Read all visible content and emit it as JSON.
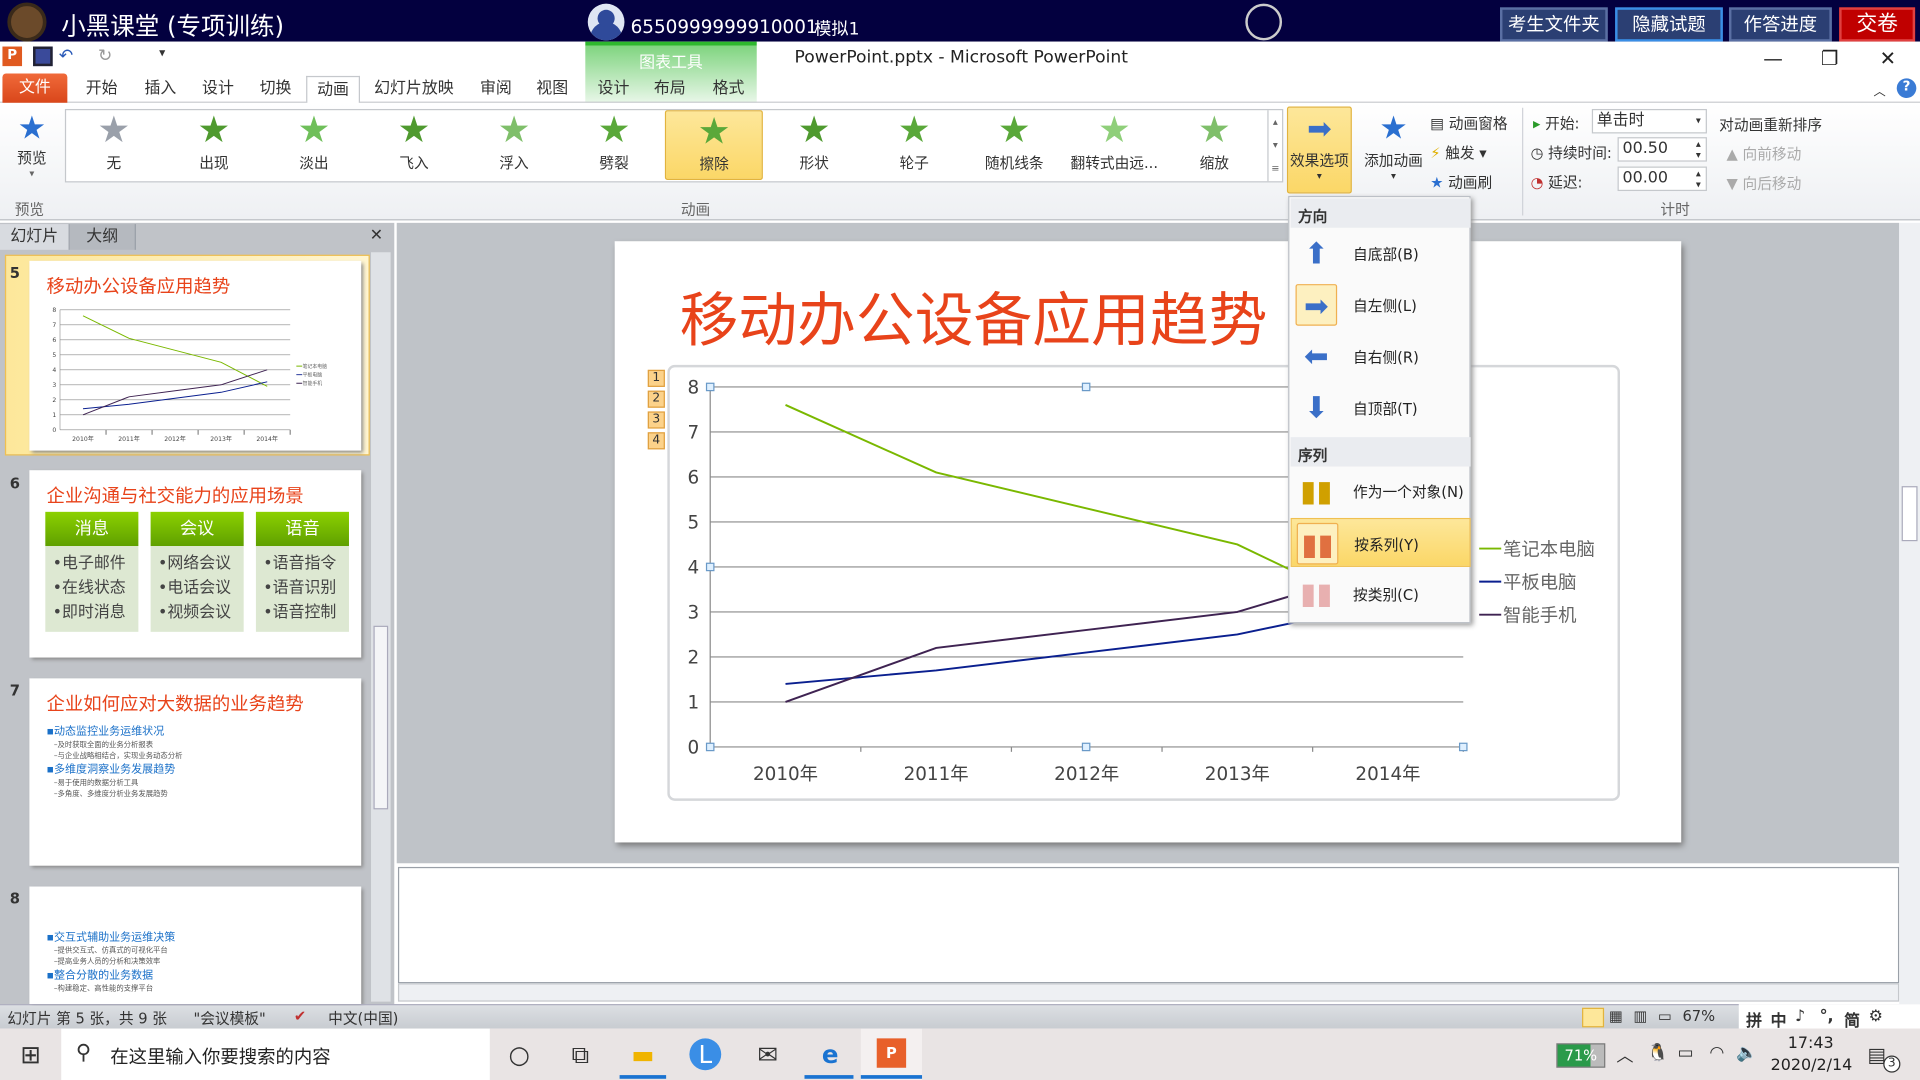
{
  "topbar": {
    "title": "小黑课堂 (专项训练)",
    "user_id": "6550999999910001",
    "mode": "模拟1",
    "buttons": [
      "考生文件夹",
      "隐藏试题",
      "作答进度",
      "交卷"
    ],
    "submit_color": "#c00000"
  },
  "window": {
    "title": "PowerPoint.pptx - Microsoft PowerPoint",
    "context_tab": "图表工具",
    "minimize": "—",
    "restore": "❐",
    "close": "✕"
  },
  "tabs": {
    "file": "文件",
    "items": [
      "开始",
      "插入",
      "设计",
      "切换",
      "动画",
      "幻灯片放映",
      "审阅",
      "视图"
    ],
    "active": "动画",
    "context_items": [
      "设计",
      "布局",
      "格式"
    ]
  },
  "ribbon": {
    "preview": "预览",
    "preview_group": "预览",
    "animations": [
      "无",
      "出现",
      "淡出",
      "飞入",
      "浮入",
      "劈裂",
      "擦除",
      "形状",
      "轮子",
      "随机线条",
      "翻转式由远...",
      "缩放"
    ],
    "selected_animation": "擦除",
    "animation_group": "动画",
    "effect_options": "效果选项",
    "add_animation": "添加动画",
    "animation_pane": "动画窗格",
    "trigger": "触发",
    "animation_painter": "动画刷",
    "start_label": "开始:",
    "start_value": "单击时",
    "duration_label": "持续时间:",
    "duration_value": "00.50",
    "delay_label": "延迟:",
    "delay_value": "00.00",
    "reorder": "对动画重新排序",
    "move_earlier": "向前移动",
    "move_later": "向后移动",
    "timing_group": "计时"
  },
  "left_pane": {
    "tabs": [
      "幻灯片",
      "大纲"
    ],
    "close": "✕",
    "slides": [
      {
        "num": "5",
        "title": "移动办公设备应用趋势"
      },
      {
        "num": "6",
        "title": "企业沟通与社交能力的应用场景",
        "columns": [
          {
            "head": "消息",
            "items": [
              "电子邮件",
              "在线状态",
              "即时消息"
            ]
          },
          {
            "head": "会议",
            "items": [
              "网络会议",
              "电话会议",
              "视频会议"
            ]
          },
          {
            "head": "语音",
            "items": [
              "语音指令",
              "语音识别",
              "语音控制"
            ]
          }
        ]
      },
      {
        "num": "7",
        "title": "企业如何应对大数据的业务趋势",
        "bullets": [
          {
            "text": "动态监控业务运维状况",
            "sub": [
              "及时获取全面的业务分析报表",
              "与企业战略相结合，实现业务动态分析"
            ]
          },
          {
            "text": "多维度洞察业务发展趋势",
            "sub": [
              "易于使用的数据分析工具",
              "多角度、多维度分析业务发展趋势"
            ]
          }
        ]
      },
      {
        "num": "8",
        "bullets": [
          {
            "text": "交互式辅助业务运维决策",
            "sub": [
              "提供交互式、仿真式的可视化平台",
              "提高业务人员的分析和决策效率"
            ]
          },
          {
            "text": "整合分散的业务数据",
            "sub": [
              "构建稳定、高性能的支撑平台"
            ]
          }
        ]
      }
    ]
  },
  "slide": {
    "title": "移动办公设备应用趋势",
    "anim_markers": [
      "1",
      "2",
      "3",
      "4"
    ]
  },
  "chart_data": {
    "type": "line",
    "categories": [
      "2010年",
      "2011年",
      "2012年",
      "2013年",
      "2014年"
    ],
    "ylim": [
      0,
      8
    ],
    "yticks": [
      "0",
      "1",
      "2",
      "3",
      "4",
      "5",
      "6",
      "7",
      "8"
    ],
    "grid": true,
    "legend": "right",
    "series": [
      {
        "name": "笔记本电脑",
        "color": "#7ab800",
        "values": [
          7.6,
          6.1,
          5.3,
          4.5,
          2.9
        ]
      },
      {
        "name": "平板电脑",
        "color": "#0a1f8f",
        "values": [
          1.4,
          1.7,
          2.1,
          2.5,
          3.2
        ]
      },
      {
        "name": "智能手机",
        "color": "#3f2352",
        "values": [
          1.0,
          2.2,
          2.6,
          3.0,
          4.0
        ]
      }
    ]
  },
  "effect_menu": {
    "direction_header": "方向",
    "directions": [
      "自底部(B)",
      "自左侧(L)",
      "自右侧(R)",
      "自顶部(T)"
    ],
    "selected_direction": "自左侧(L)",
    "sequence_header": "序列",
    "sequences": [
      "作为一个对象(N)",
      "按系列(Y)",
      "按类别(C)"
    ],
    "selected_sequence": "按系列(Y)"
  },
  "statusbar": {
    "slide_info": "幻灯片 第 5 张，共 9 张",
    "theme": "\"会议模板\"",
    "language": "中文(中国)",
    "zoom": "67%",
    "ime": [
      "拼",
      "中",
      "♪",
      "°,",
      "简",
      "⚙"
    ]
  },
  "taskbar": {
    "search_placeholder": "在这里输入你要搜索的内容",
    "battery": "71%",
    "time": "17:43",
    "date": "2020/2/14",
    "notifications": "3"
  }
}
